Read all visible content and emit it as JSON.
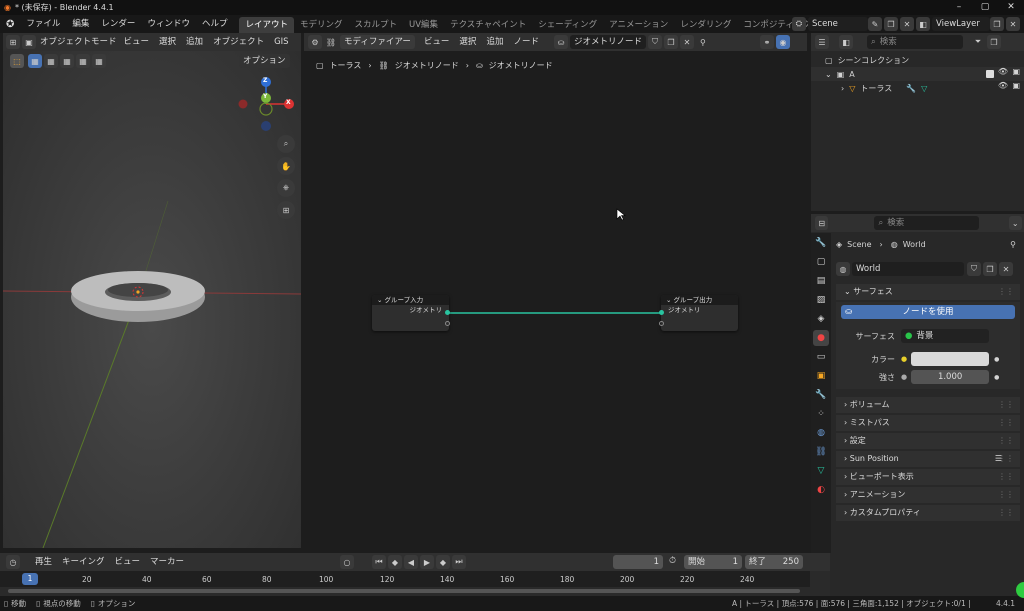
{
  "window": {
    "title": "* (未保存) - Blender 4.4.1"
  },
  "menu": {
    "items": [
      "ファイル",
      "編集",
      "レンダー",
      "ウィンドウ",
      "ヘルプ"
    ],
    "workspaces": [
      "レイアウト",
      "モデリング",
      "スカルプト",
      "UV編集",
      "テクスチャペイント",
      "シェーディング",
      "アニメーション",
      "レンダリング",
      "コンポジティング"
    ],
    "scene": "Scene",
    "view_layer": "ViewLayer"
  },
  "viewport": {
    "mode": "オブジェクトモード",
    "menus": [
      "ビュー",
      "選択",
      "追加",
      "オブジェクト",
      "GIS"
    ],
    "options": "オプション",
    "gizmo": {
      "z": "Z",
      "y": "Y",
      "x": "X"
    }
  },
  "node_editor": {
    "type": "モディファイアー",
    "menus": [
      "ビュー",
      "選択",
      "追加",
      "ノード"
    ],
    "tree_name": "ジオメトリノード",
    "breadcrumb": [
      "トーラス",
      "ジオメトリノード",
      "ジオメトリノード"
    ],
    "group_input": {
      "title": "グループ入力",
      "socket": "ジオメトリ"
    },
    "group_output": {
      "title": "グループ出力",
      "socket": "ジオメトリ"
    }
  },
  "outliner": {
    "search_placeholder": "検索",
    "scene_collection": "シーンコレクション",
    "collection": "A",
    "object": "トーラス"
  },
  "properties": {
    "search_placeholder": "検索",
    "breadcrumb": [
      "Scene",
      "World"
    ],
    "world_name": "World",
    "surface_panel": "サーフェス",
    "use_nodes": "ノードを使用",
    "surface_label": "サーフェス",
    "surface_value": "背景",
    "color_label": "カラー",
    "color_value": "#d9d9d9",
    "strength_label": "強さ",
    "strength_value": "1.000",
    "panels": [
      "ボリューム",
      "ミストパス",
      "設定",
      "Sun Position",
      "ビューポート表示",
      "アニメーション",
      "カスタムプロパティ"
    ]
  },
  "timeline": {
    "menus": [
      "再生",
      "キーイング",
      "ビュー",
      "マーカー"
    ],
    "current_frame": "1",
    "start_label": "開始",
    "start": "1",
    "end_label": "終了",
    "end": "250",
    "ticks": [
      "1",
      "20",
      "40",
      "60",
      "80",
      "100",
      "120",
      "140",
      "160",
      "180",
      "200",
      "220",
      "240"
    ]
  },
  "status": {
    "hints": [
      "移動",
      "視点の移動",
      "オプション"
    ],
    "info": "A | トーラス | 頂点:576 | 面:576 | 三角面:1,152 | オブジェクト:0/1 |",
    "version": "4.4.1"
  }
}
